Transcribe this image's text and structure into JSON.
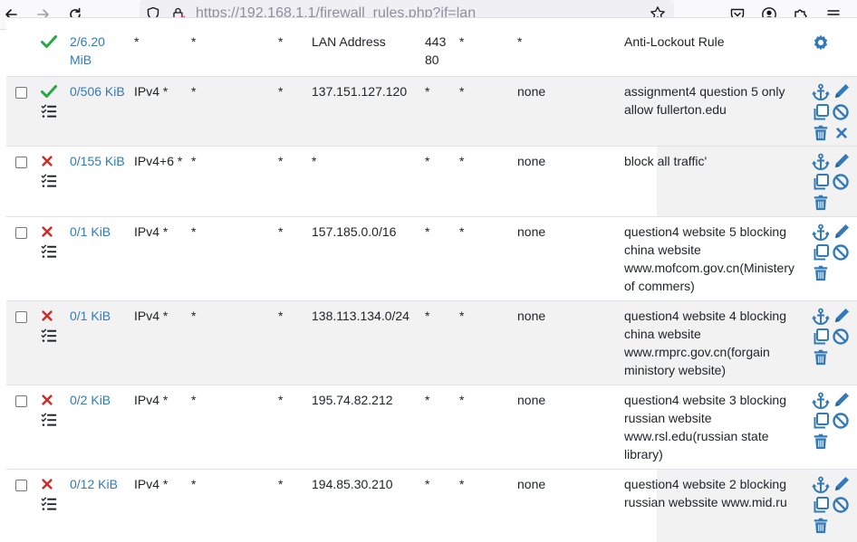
{
  "browser": {
    "url_host": "https://192.168.1.1",
    "url_path": "/firewall_rules.php?if=lan"
  },
  "colors": {
    "pass": "#28a745",
    "block": "#c9302c",
    "action": "#337ab7",
    "row_alt": "#f2f2f2"
  },
  "rows": [
    {
      "action": "pass",
      "states": "2/6.20 MiB",
      "protocol": "*",
      "source": "*",
      "port": "*",
      "destination": "LAN Address",
      "dest_port": "443 80",
      "gateway": "*",
      "queue": "*",
      "schedule": "",
      "description": "Anti-Lockout Rule",
      "actions_icons": [
        "gear-icon"
      ]
    },
    {
      "action": "pass",
      "states": "0/506 KiB",
      "protocol": "IPv4 *",
      "source": "*",
      "port": "*",
      "destination": "137.151.127.120",
      "dest_port": "*",
      "gateway": "*",
      "queue": "none",
      "schedule": "",
      "description": "assignment4 question 5 only allow fullerton.edu",
      "actions_icons": [
        "anchor-icon",
        "pencil-icon",
        "copy-icon",
        "disable-icon",
        "trash-icon",
        "close-icon"
      ]
    },
    {
      "action": "block",
      "states": "0/155 KiB",
      "protocol": "IPv4+6 *",
      "source": "*",
      "port": "*",
      "destination": "*",
      "dest_port": "*",
      "gateway": "*",
      "queue": "none",
      "schedule": "",
      "description": "block all traffic'",
      "actions_icons": [
        "anchor-icon",
        "pencil-icon",
        "copy-icon",
        "disable-icon",
        "trash-icon"
      ]
    },
    {
      "action": "block",
      "states": "0/1 KiB",
      "protocol": "IPv4 *",
      "source": "*",
      "port": "*",
      "destination": "157.185.0.0/16",
      "dest_port": "*",
      "gateway": "*",
      "queue": "none",
      "schedule": "",
      "description": "question4 website 5 blocking china website www.mofcom.gov.cn(Ministery of commers)",
      "actions_icons": [
        "anchor-icon",
        "pencil-icon",
        "copy-icon",
        "disable-icon",
        "trash-icon"
      ]
    },
    {
      "action": "block",
      "states": "0/1 KiB",
      "protocol": "IPv4 *",
      "source": "*",
      "port": "*",
      "destination": "138.113.134.0/24",
      "dest_port": "*",
      "gateway": "*",
      "queue": "none",
      "schedule": "",
      "description": "question4 website 4 blocking china website www.rmprc.gov.cn(forgain ministory website)",
      "actions_icons": [
        "anchor-icon",
        "pencil-icon",
        "copy-icon",
        "disable-icon",
        "trash-icon"
      ]
    },
    {
      "action": "block",
      "states": "0/2 KiB",
      "protocol": "IPv4 *",
      "source": "*",
      "port": "*",
      "destination": "195.74.82.212",
      "dest_port": "*",
      "gateway": "*",
      "queue": "none",
      "schedule": "",
      "description": "question4 website 3 blocking russian website www.rsl.edu(russian state library)",
      "actions_icons": [
        "anchor-icon",
        "pencil-icon",
        "copy-icon",
        "disable-icon",
        "trash-icon"
      ]
    },
    {
      "action": "block",
      "states": "0/12 KiB",
      "protocol": "IPv4 *",
      "source": "*",
      "port": "*",
      "destination": "194.85.30.210",
      "dest_port": "*",
      "gateway": "*",
      "queue": "none",
      "schedule": "",
      "description": "question4 website 2 blocking russian webssite www.mid.ru",
      "actions_icons": [
        "anchor-icon",
        "pencil-icon",
        "copy-icon",
        "disable-icon",
        "trash-icon"
      ]
    }
  ]
}
